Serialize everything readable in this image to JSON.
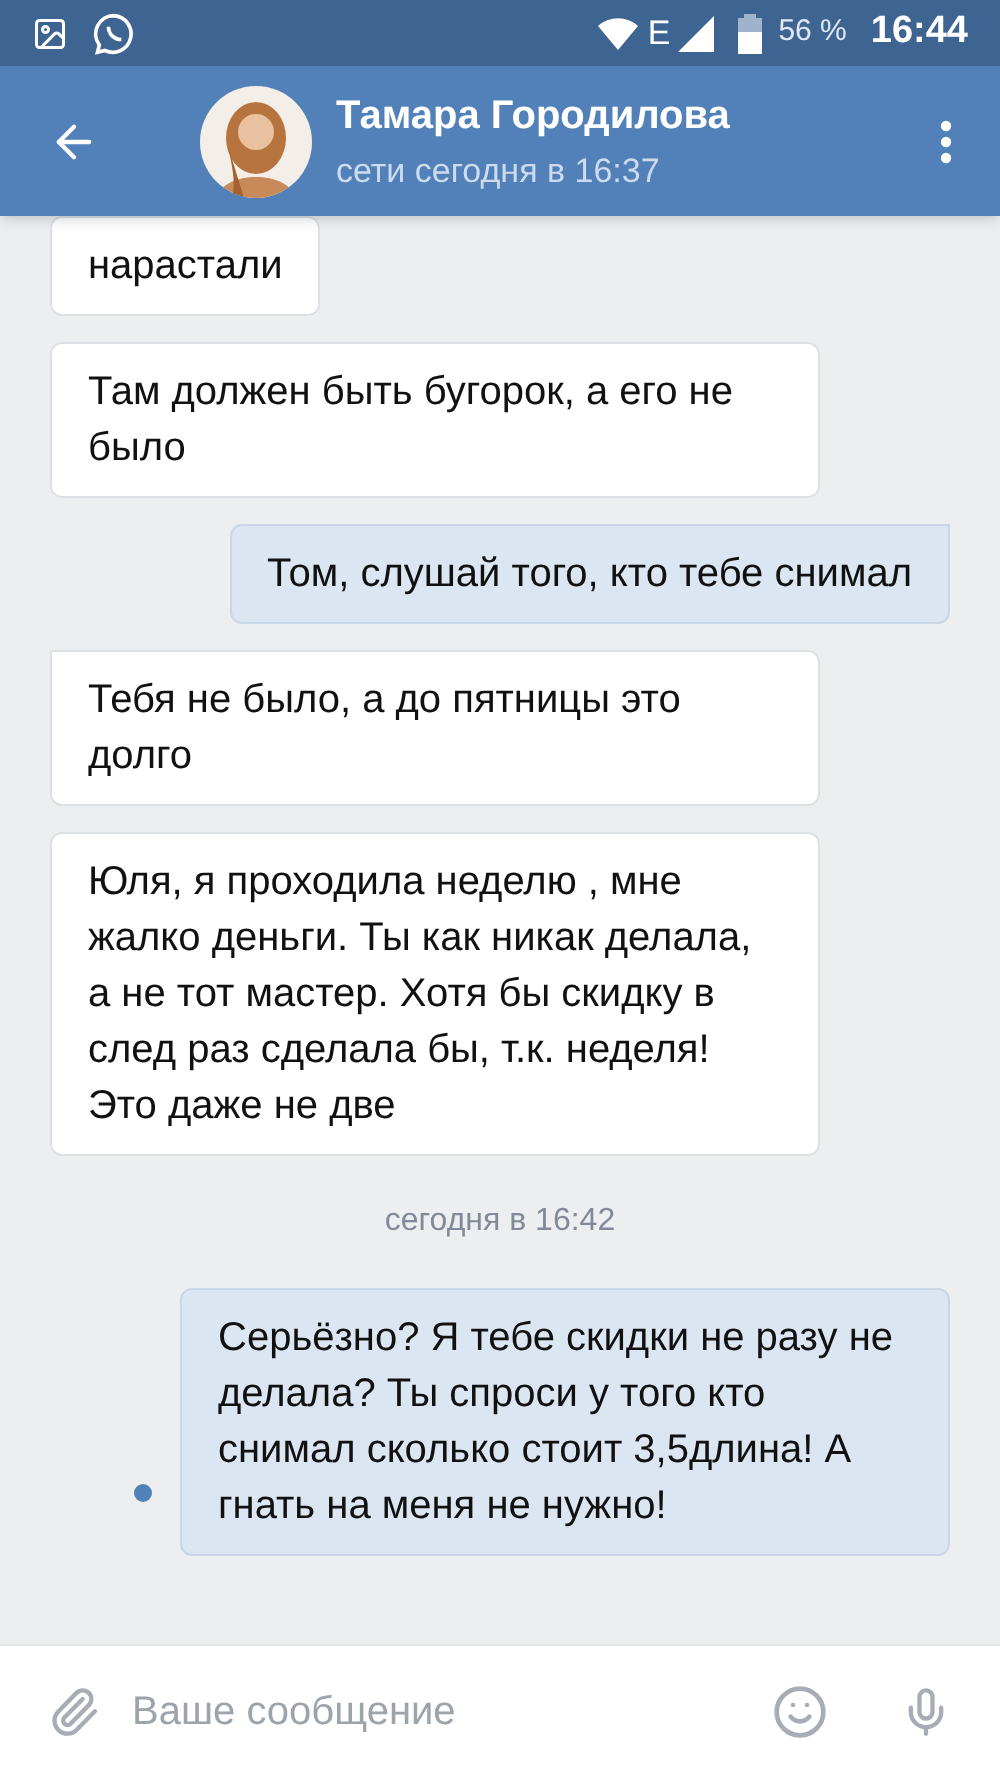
{
  "status_bar": {
    "network": "E",
    "battery": "56 %",
    "time": "16:44"
  },
  "header": {
    "name": "Тамара Городилова",
    "status": "сети сегодня в 16:37"
  },
  "messages": [
    {
      "kind": "incoming",
      "text": "нарастали",
      "tail": false,
      "dot": false
    },
    {
      "kind": "incoming",
      "text": "Там должен быть бугорок, а его не было",
      "tail": false,
      "dot": false
    },
    {
      "kind": "outgoing",
      "text": "Том, слушай того, кто тебе снимал",
      "tail": true,
      "dot": false
    },
    {
      "kind": "incoming",
      "text": "Тебя не было, а до пятницы это долго",
      "tail": true,
      "dot": false
    },
    {
      "kind": "incoming",
      "text": "Юля, я проходила неделю , мне жалко деньги. Ты как никак делала, а не тот мастер. Хотя бы скидку в след раз сделала бы, т.к. неделя! Это даже не две",
      "tail": false,
      "dot": false
    },
    {
      "kind": "date",
      "text": "сегодня в 16:42"
    },
    {
      "kind": "outgoing",
      "text": "Серьёзно? Я тебе скидки не разу не делала? Ты спроси у того кто снимал сколько стоит 3,5длина! А гнать на меня не нужно!",
      "tail": false,
      "dot": true
    }
  ],
  "composer": {
    "placeholder": "Ваше сообщение"
  }
}
